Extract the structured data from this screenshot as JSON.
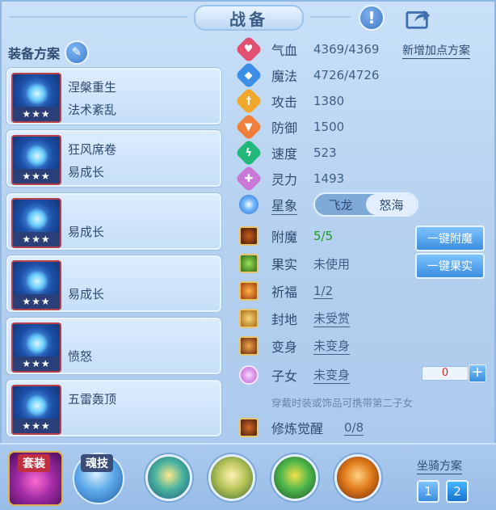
{
  "window": {
    "title": "战备"
  },
  "plans": {
    "header": "装备方案"
  },
  "equipment": [
    {
      "line1": "涅槃重生",
      "line2": "法术紊乱",
      "stars": "★★★"
    },
    {
      "line1": "狂风席卷",
      "line2": "易成长",
      "stars": "★★★"
    },
    {
      "line1": "",
      "line2": "易成长",
      "stars": "★★★"
    },
    {
      "line1": "",
      "line2": "易成长",
      "stars": "★★★"
    },
    {
      "line1": "",
      "line2": "愤怒",
      "stars": "★★★"
    },
    {
      "line1": "五雷轰顶",
      "line2": "",
      "stars": "★★★"
    }
  ],
  "stats": [
    {
      "label": "气血",
      "value": "4369/4369",
      "color": "#e2506f",
      "icon": "heart-icon"
    },
    {
      "label": "魔法",
      "value": "4726/4726",
      "color": "#3c8fe6",
      "icon": "mana-icon"
    },
    {
      "label": "攻击",
      "value": "1380",
      "color": "#f0a72a",
      "icon": "sword-icon"
    },
    {
      "label": "防御",
      "value": "1500",
      "color": "#f07f3d",
      "icon": "shield-icon"
    },
    {
      "label": "速度",
      "value": "523",
      "color": "#22b87a",
      "icon": "lightning-icon"
    },
    {
      "label": "灵力",
      "value": "1493",
      "color": "#c978d8",
      "icon": "spirit-icon"
    }
  ],
  "add_points_link": "新增加点方案",
  "constellation": {
    "label": "星象",
    "option_a": "飞龙",
    "option_b": "怒海",
    "selected": "怒海"
  },
  "extras": [
    {
      "label": "附魔",
      "value": "5/5"
    },
    {
      "label": "果实",
      "value": "未使用"
    },
    {
      "label": "祈福",
      "value": "1/2"
    },
    {
      "label": "封地",
      "value": "未受赏"
    },
    {
      "label": "变身",
      "value": "未变身"
    },
    {
      "label": "子女",
      "value": "未变身"
    }
  ],
  "buttons": {
    "enchant": "一键附魔",
    "fruit": "一键果实"
  },
  "counter": {
    "value": "0",
    "plus": "+"
  },
  "hint": "穿戴时装或饰品可携带第二子女",
  "awaken": {
    "label": "修炼觉醒",
    "value": "0/8"
  },
  "bottom": {
    "suit_tab": "套装",
    "skill_tab": "魂技",
    "mount_header": "坐骑方案",
    "mount_1": "1",
    "mount_2": "2"
  },
  "colors": {
    "accent": "#3b8ee0",
    "text": "#2f4d72",
    "green": "#1c9b2a",
    "red": "#d02a2a"
  }
}
